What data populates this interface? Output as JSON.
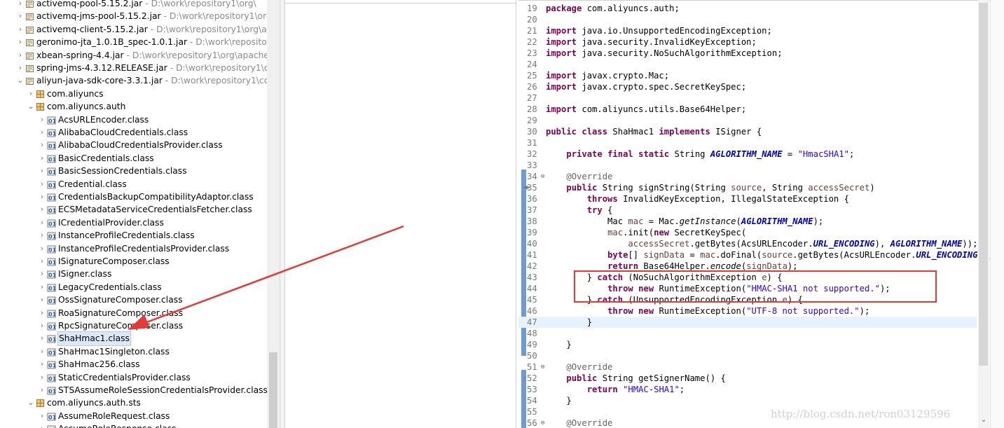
{
  "tree": {
    "items": [
      {
        "icon": "jar",
        "label": "activemq-pool-5.15.2.jar",
        "path": " - D:\\work\\repository1\\org\\",
        "twisty": "›",
        "indent": 0,
        "y": -6
      },
      {
        "icon": "jar",
        "label": "activemq-jms-pool-5.15.2.jar",
        "path": " - D:\\work\\repository1\\org\\",
        "twisty": "›",
        "indent": 0
      },
      {
        "icon": "jar",
        "label": "activemq-client-5.15.2.jar",
        "path": " - D:\\work\\repository1\\org\\apa",
        "twisty": "›",
        "indent": 0
      },
      {
        "icon": "jar",
        "label": "geronimo-jta_1.0.1B_spec-1.0.1.jar",
        "path": " - D:\\work\\repository1",
        "twisty": "›",
        "indent": 0
      },
      {
        "icon": "jar",
        "label": "xbean-spring-4.4.jar",
        "path": " - D:\\work\\repository1\\org\\apache\\x",
        "twisty": "›",
        "indent": 0
      },
      {
        "icon": "jar",
        "label": "spring-jms-4.3.12.RELEASE.jar",
        "path": " - D:\\work\\repository1\\org",
        "twisty": "›",
        "indent": 0
      },
      {
        "icon": "jar",
        "label": "aliyun-java-sdk-core-3.3.1.jar",
        "path": " - D:\\work\\repository1\\com",
        "twisty": "⌄",
        "indent": 0
      },
      {
        "icon": "pkg",
        "label": "com.aliyuncs",
        "path": "",
        "twisty": "›",
        "indent": 1
      },
      {
        "icon": "pkg",
        "label": "com.aliyuncs.auth",
        "path": "",
        "twisty": "⌄",
        "indent": 1
      },
      {
        "icon": "cls",
        "label": "AcsURLEncoder.class",
        "path": "",
        "twisty": "›",
        "indent": 2
      },
      {
        "icon": "cls",
        "label": "AlibabaCloudCredentials.class",
        "path": "",
        "twisty": "›",
        "indent": 2
      },
      {
        "icon": "cls",
        "label": "AlibabaCloudCredentialsProvider.class",
        "path": "",
        "twisty": "›",
        "indent": 2
      },
      {
        "icon": "cls",
        "label": "BasicCredentials.class",
        "path": "",
        "twisty": "›",
        "indent": 2
      },
      {
        "icon": "cls",
        "label": "BasicSessionCredentials.class",
        "path": "",
        "twisty": "›",
        "indent": 2
      },
      {
        "icon": "cls",
        "label": "Credential.class",
        "path": "",
        "twisty": "›",
        "indent": 2
      },
      {
        "icon": "cls",
        "label": "CredentialsBackupCompatibilityAdaptor.class",
        "path": "",
        "twisty": "›",
        "indent": 2
      },
      {
        "icon": "cls",
        "label": "ECSMetadataServiceCredentialsFetcher.class",
        "path": "",
        "twisty": "›",
        "indent": 2
      },
      {
        "icon": "cls",
        "label": "ICredentialProvider.class",
        "path": "",
        "twisty": "›",
        "indent": 2
      },
      {
        "icon": "cls",
        "label": "InstanceProfileCredentials.class",
        "path": "",
        "twisty": "›",
        "indent": 2
      },
      {
        "icon": "cls",
        "label": "InstanceProfileCredentialsProvider.class",
        "path": "",
        "twisty": "›",
        "indent": 2
      },
      {
        "icon": "cls",
        "label": "ISignatureComposer.class",
        "path": "",
        "twisty": "›",
        "indent": 2
      },
      {
        "icon": "cls",
        "label": "ISigner.class",
        "path": "",
        "twisty": "›",
        "indent": 2
      },
      {
        "icon": "cls",
        "label": "LegacyCredentials.class",
        "path": "",
        "twisty": "›",
        "indent": 2
      },
      {
        "icon": "cls",
        "label": "OssSignatureComposer.class",
        "path": "",
        "twisty": "›",
        "indent": 2
      },
      {
        "icon": "cls",
        "label": "RoaSignatureComposer.class",
        "path": "",
        "twisty": "›",
        "indent": 2
      },
      {
        "icon": "cls",
        "label": "RpcSignatureComposer.class",
        "path": "",
        "twisty": "›",
        "indent": 2
      },
      {
        "icon": "cls",
        "label": "ShaHmac1.class",
        "path": "",
        "twisty": "›",
        "indent": 2,
        "selected": true
      },
      {
        "icon": "cls",
        "label": "ShaHmac1Singleton.class",
        "path": "",
        "twisty": "›",
        "indent": 2
      },
      {
        "icon": "cls",
        "label": "ShaHmac256.class",
        "path": "",
        "twisty": "›",
        "indent": 2
      },
      {
        "icon": "cls",
        "label": "StaticCredentialsProvider.class",
        "path": "",
        "twisty": "›",
        "indent": 2
      },
      {
        "icon": "cls",
        "label": "STSAssumeRoleSessionCredentialsProvider.class",
        "path": "",
        "twisty": "›",
        "indent": 2
      },
      {
        "icon": "pkg",
        "label": "com.aliyuncs.auth.sts",
        "path": "",
        "twisty": "⌄",
        "indent": 1
      },
      {
        "icon": "cls",
        "label": "AssumeRoleRequest.class",
        "path": "",
        "twisty": "›",
        "indent": 2
      },
      {
        "icon": "cls",
        "label": "AssumeRoleResponse.class",
        "path": "",
        "twisty": "›",
        "indent": 2
      }
    ]
  },
  "editor": {
    "lines": [
      {
        "n": "19",
        "html": "<span class=\"kw\">package</span> com.aliyuncs.auth;"
      },
      {
        "n": "20",
        "html": ""
      },
      {
        "n": "21",
        "html": "<span class=\"kw\">import</span> java.io.UnsupportedEncodingException;"
      },
      {
        "n": "22",
        "html": "<span class=\"kw\">import</span> java.security.InvalidKeyException;"
      },
      {
        "n": "23",
        "html": "<span class=\"kw\">import</span> java.security.NoSuchAlgorithmException;"
      },
      {
        "n": "24",
        "html": ""
      },
      {
        "n": "25",
        "html": "<span class=\"kw\">import</span> javax.crypto.Mac;"
      },
      {
        "n": "26",
        "html": "<span class=\"kw\">import</span> javax.crypto.spec.SecretKeySpec;"
      },
      {
        "n": "27",
        "html": ""
      },
      {
        "n": "28",
        "html": "<span class=\"kw\">import</span> com.aliyuncs.utils.Base64Helper;"
      },
      {
        "n": "29",
        "html": ""
      },
      {
        "n": "30",
        "html": "<span class=\"kw\">public</span> <span class=\"kw\">class</span> ShaHmac1 <span class=\"kw\">implements</span> ISigner {"
      },
      {
        "n": "31",
        "html": ""
      },
      {
        "n": "32",
        "html": "    <span class=\"kw\">private</span> <span class=\"kw\">final</span> <span class=\"kw\">static</span> String <span class=\"fld\">AGLORITHM_NAME</span> = <span class=\"str\">\"HmacSHA1\"</span>;"
      },
      {
        "n": "33",
        "html": ""
      },
      {
        "n": "34",
        "html": "    <span class=\"ann\">@Override</span>",
        "fold": "⊖"
      },
      {
        "n": "35",
        "html": "    <span class=\"kw\">public</span> String signString(String <span class=\"var\">source</span>, String <span class=\"var\">accessSecret</span>)",
        "mark": "◀▶"
      },
      {
        "n": "36",
        "html": "        <span class=\"kw\">throws</span> InvalidKeyException, IllegalStateException {"
      },
      {
        "n": "37",
        "html": "        <span class=\"kw\">try</span> {"
      },
      {
        "n": "38",
        "html": "            Mac <span class=\"var\">mac</span> = Mac.<span class=\"st\">getInstance</span>(<span class=\"fld\">AGLORITHM_NAME</span>);"
      },
      {
        "n": "39",
        "html": "            <span class=\"var\">mac</span>.init(<span class=\"kw\">new</span> SecretKeySpec("
      },
      {
        "n": "40",
        "html": "                <span class=\"var\">accessSecret</span>.getBytes(AcsURLEncoder.<span class=\"fld\">URL_ENCODING</span>), <span class=\"fld\">AGLORITHM_NAME</span>));"
      },
      {
        "n": "41",
        "html": "            <span class=\"kw\">byte</span>[] <span class=\"var\">signData</span> = <span class=\"var\">mac</span>.doFinal(<span class=\"var\">source</span>.getBytes(AcsURLEncoder.<span class=\"fld\">URL_ENCODING</span>));"
      },
      {
        "n": "42",
        "html": "            <span class=\"kw\">return</span> Base64Helper.<span class=\"st\">encode</span>(<span class=\"var\">signData</span>);"
      },
      {
        "n": "43",
        "html": "        } <span class=\"kw\">catch</span> (NoSuchAlgorithmException <span class=\"var\">e</span>) {"
      },
      {
        "n": "44",
        "html": "            <span class=\"kw\">throw</span> <span class=\"kw\">new</span> RuntimeException(<span class=\"str\">\"HMAC-SHA1 not supported.\"</span>);"
      },
      {
        "n": "45",
        "html": "        } <span class=\"kw\">catch</span> (UnsupportedEncodingException <span class=\"var\">e</span>) {"
      },
      {
        "n": "46",
        "html": "            <span class=\"kw\">throw</span> <span class=\"kw\">new</span> RuntimeException(<span class=\"str\">\"UTF-8 not supported.\"</span>);"
      },
      {
        "n": "47",
        "html": "        }",
        "current": true
      },
      {
        "n": "48",
        "html": ""
      },
      {
        "n": "49",
        "html": "    }"
      },
      {
        "n": "50",
        "html": ""
      },
      {
        "n": "51",
        "html": "    <span class=\"ann\">@Override</span>",
        "fold": "⊖"
      },
      {
        "n": "52",
        "html": "    <span class=\"kw\">public</span> String getSignerName() {",
        "mark": "△"
      },
      {
        "n": "53",
        "html": "        <span class=\"kw\">return</span> <span class=\"str\">\"HMAC-SHA1\"</span>;"
      },
      {
        "n": "54",
        "html": "    }"
      },
      {
        "n": "55",
        "html": ""
      },
      {
        "n": "56",
        "html": "    <span class=\"ann\">@Override</span>",
        "fold": "⊖"
      }
    ]
  },
  "watermark": "http://blog.csdn.net/ron03129596",
  "colors": {
    "highlight": "#e53935",
    "selection": "#dbe8f8",
    "keyword": "#7f0055",
    "string": "#2a00ff"
  }
}
